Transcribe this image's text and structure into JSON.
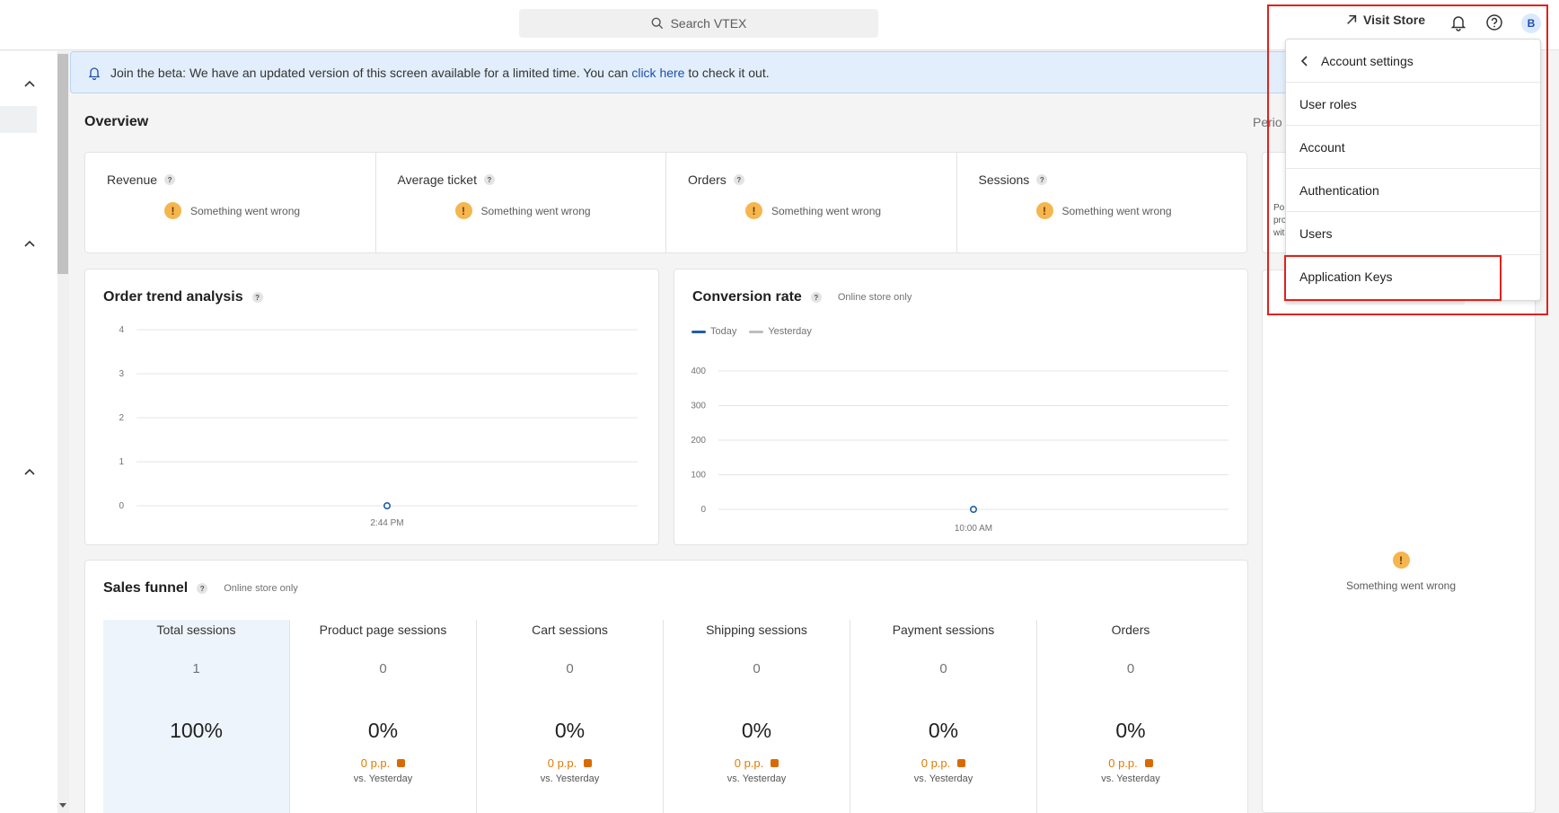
{
  "topbar": {
    "search_placeholder": "Search VTEX",
    "visit_store": "Visit Store",
    "avatar_initial": "B"
  },
  "banner": {
    "text_before": "Join the beta: We have an updated version of this screen available for a limited time. You can ",
    "link": "click here",
    "text_after": " to check it out."
  },
  "overview": {
    "title": "Overview",
    "period_label": "Perio",
    "metrics": [
      {
        "label": "Revenue",
        "status": "Something went wrong"
      },
      {
        "label": "Average ticket",
        "status": "Something went wrong"
      },
      {
        "label": "Orders",
        "status": "Something went wrong"
      },
      {
        "label": "Sessions",
        "status": "Something went wrong"
      }
    ]
  },
  "order_trend": {
    "title": "Order trend analysis",
    "chart_data": {
      "type": "line",
      "x": [
        "2:44 PM"
      ],
      "series": [
        {
          "values": [
            0
          ]
        }
      ],
      "ylim": [
        0,
        4
      ],
      "yticks": [
        "4",
        "3",
        "2",
        "1",
        "0"
      ],
      "grid": true
    }
  },
  "conversion": {
    "title": "Conversion rate",
    "subtitle": "Online store only",
    "legend_today": "Today",
    "legend_yesterday": "Yesterday",
    "colors": {
      "today": "#1f5fa8",
      "yesterday": "#bdbdbd"
    },
    "chart_data": {
      "type": "line",
      "x": [
        "10:00 AM"
      ],
      "series": [
        {
          "name": "Today",
          "values": [
            0
          ]
        },
        {
          "name": "Yesterday",
          "values": []
        }
      ],
      "ylim": [
        0,
        400
      ],
      "yticks": [
        "400",
        "300",
        "200",
        "100",
        "0"
      ],
      "grid": true,
      "legend": "top-left"
    }
  },
  "funnel": {
    "title": "Sales funnel",
    "subtitle": "Online store only",
    "columns": [
      {
        "label": "Total sessions",
        "count": "1",
        "pct": "100%",
        "pp": "",
        "vs": ""
      },
      {
        "label": "Product page sessions",
        "count": "0",
        "pct": "0%",
        "pp": "0 p.p.",
        "vs": "vs. Yesterday"
      },
      {
        "label": "Cart sessions",
        "count": "0",
        "pct": "0%",
        "pp": "0 p.p.",
        "vs": "vs. Yesterday"
      },
      {
        "label": "Shipping sessions",
        "count": "0",
        "pct": "0%",
        "pp": "0 p.p.",
        "vs": "vs. Yesterday"
      },
      {
        "label": "Payment sessions",
        "count": "0",
        "pct": "0%",
        "pp": "0 p.p.",
        "vs": "vs. Yesterday"
      },
      {
        "label": "Orders",
        "count": "0",
        "pct": "0%",
        "pp": "0 p.p.",
        "vs": "vs. Yesterday"
      }
    ]
  },
  "right_panel": {
    "status": "Something went wrong",
    "peek_lines": [
      "Po",
      "pro",
      "wit"
    ]
  },
  "menu": {
    "header": "Account settings",
    "items": [
      "User roles",
      "Account",
      "Authentication",
      "Users",
      "Application Keys"
    ]
  }
}
